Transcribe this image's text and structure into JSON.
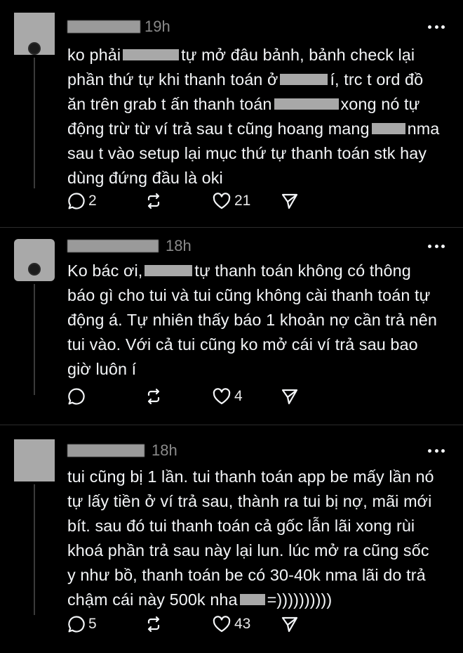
{
  "posts": [
    {
      "time": "19h",
      "lines": [
        [
          "ko phải",
          "",
          "tự mở đâu bảnh, bảnh check lại"
        ],
        [
          "phần thứ tự khi thanh toán ở",
          "",
          "í, trc t ord đồ"
        ],
        [
          "ăn trên grab t ấn thanh toán",
          "",
          "xong nó tự"
        ],
        [
          "động trừ từ ví trả sau t cũng hoang mang",
          "",
          "nma"
        ],
        [
          "sau t vào setup lại mục thứ tự thanh toán stk hay"
        ],
        [
          "dùng đứng đầu là oki"
        ]
      ],
      "replies": "2",
      "likes": "21"
    },
    {
      "time": "18h",
      "lines": [
        [
          "Ko bác ơi,",
          "",
          "tự thanh toán không có thông"
        ],
        [
          "báo gì cho tui và tui cũng không cài thanh toán tự"
        ],
        [
          "động á. Tự nhiên thấy báo 1 khoản nợ cần trả nên"
        ],
        [
          "tui vào. Với cả tui cũng ko mở cái ví trả sau bao"
        ],
        [
          "giờ luôn í"
        ]
      ],
      "replies": "",
      "likes": "4"
    },
    {
      "time": "18h",
      "lines": [
        [
          "tui cũng bị 1 lần. tui thanh toán app be mấy lần nó"
        ],
        [
          "tự lấy tiền ở ví trả sau, thành ra tui bị nợ, mãi mới"
        ],
        [
          "bít. sau đó tui thanh toán cả gốc lẫn lãi xong rùi"
        ],
        [
          "khoá phần trả sau này lại lun. lúc mở ra cũng sốc"
        ],
        [
          "y như bồ, thanh toán be có 30-40k nma lãi do trả"
        ],
        [
          "chậm cái này 500k nha",
          "",
          "=))))))))))"
        ]
      ],
      "replies": "5",
      "likes": "43"
    }
  ],
  "icons": {
    "reply": "reply-bubble-icon",
    "repost": "repost-icon",
    "like": "heart-icon",
    "share": "send-icon",
    "more": "more-dots-icon"
  },
  "colors": {
    "background": "#000000",
    "text": "#f3f5f7",
    "muted": "#8a8a8a",
    "redaction": "#a8a8a8"
  }
}
